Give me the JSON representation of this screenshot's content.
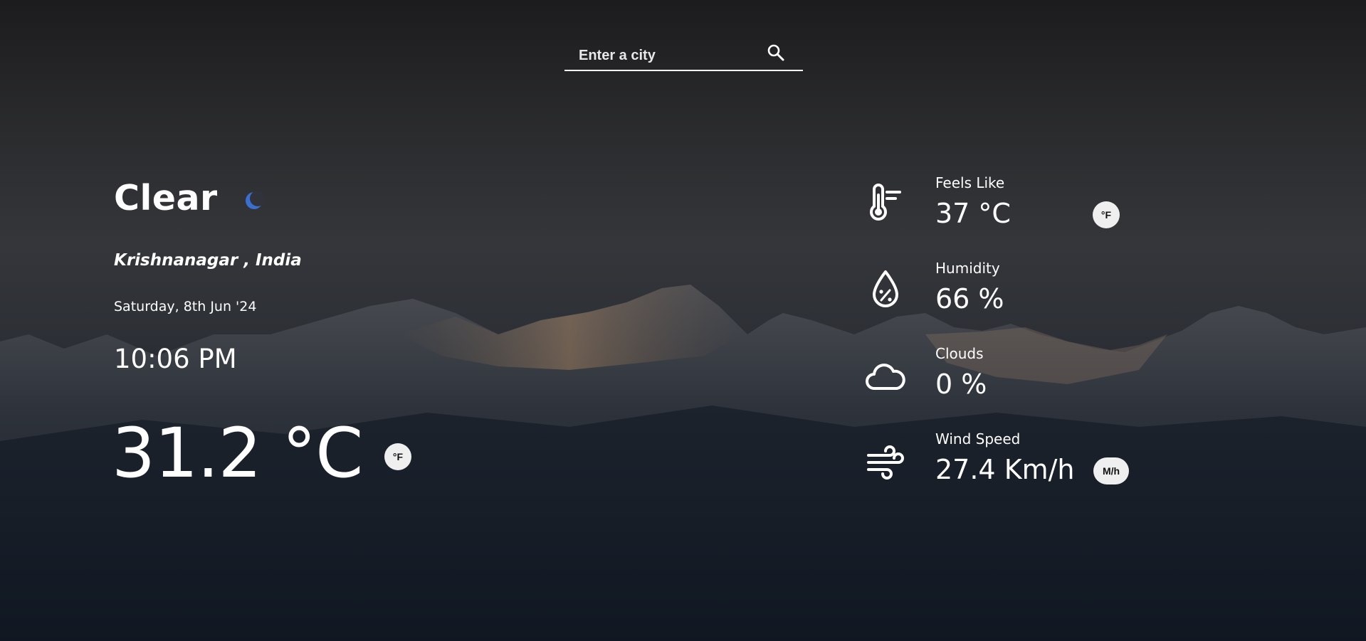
{
  "search": {
    "placeholder": "Enter a city"
  },
  "weather": {
    "condition": "Clear",
    "condition_icon": "moon-icon",
    "location": "Krishnanagar , India",
    "date": "Saturday, 8th Jun '24",
    "time": "10:06 PM",
    "temperature": "31.2 °C",
    "temp_toggle_label": "°F"
  },
  "stats": {
    "feels_like": {
      "label": "Feels Like",
      "value": "37 °C",
      "toggle_label": "°F",
      "icon": "thermometer-icon"
    },
    "humidity": {
      "label": "Humidity",
      "value": "66 %",
      "icon": "humidity-drop-icon"
    },
    "clouds": {
      "label": "Clouds",
      "value": "0 %",
      "icon": "cloud-icon"
    },
    "wind_speed": {
      "label": "Wind Speed",
      "value": "27.4 Km/h",
      "toggle_label": "M/h",
      "icon": "wind-icon"
    }
  },
  "colors": {
    "text": "#ffffff",
    "toggle_bg": "#efefef",
    "moon": "#3a6fd0"
  }
}
